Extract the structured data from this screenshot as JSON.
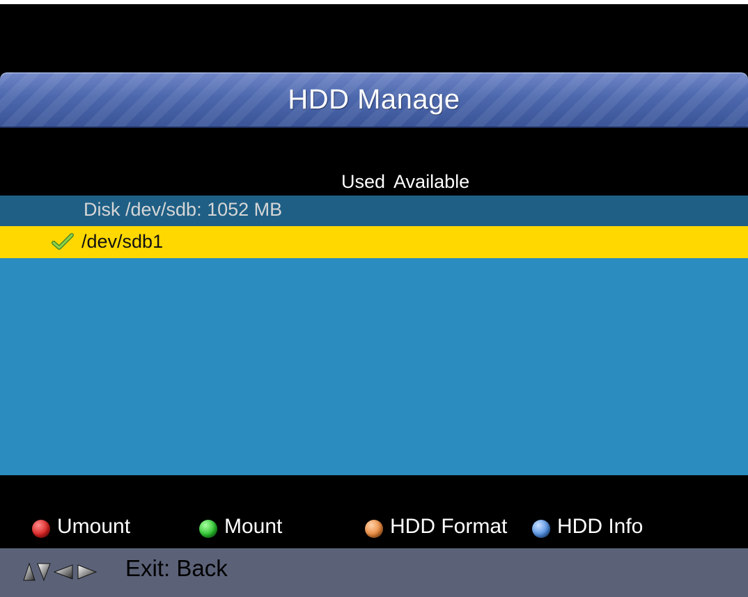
{
  "header": {
    "title": "HDD Manage"
  },
  "columns": {
    "used": "Used",
    "available": "Available"
  },
  "disk": {
    "label": "Disk /dev/sdb: 1052 MB"
  },
  "partitions": [
    {
      "name": "/dev/sdb1",
      "selected": true,
      "mounted": true
    }
  ],
  "color_keys": [
    {
      "color": "#d62020",
      "label": "Umount"
    },
    {
      "color": "#27c12b",
      "label": "Mount"
    },
    {
      "color": "#e8863a",
      "label": "HDD Format"
    },
    {
      "color": "#4f8ee0",
      "label": "HDD Info"
    }
  ],
  "footer": {
    "hint": "Exit: Back"
  },
  "colors": {
    "title_bar": "#4d68ad",
    "disk_row": "#1f5f85",
    "selected_row": "#ffd800",
    "list_bg": "#2b8cbf",
    "footer_bg": "#5b6278"
  }
}
